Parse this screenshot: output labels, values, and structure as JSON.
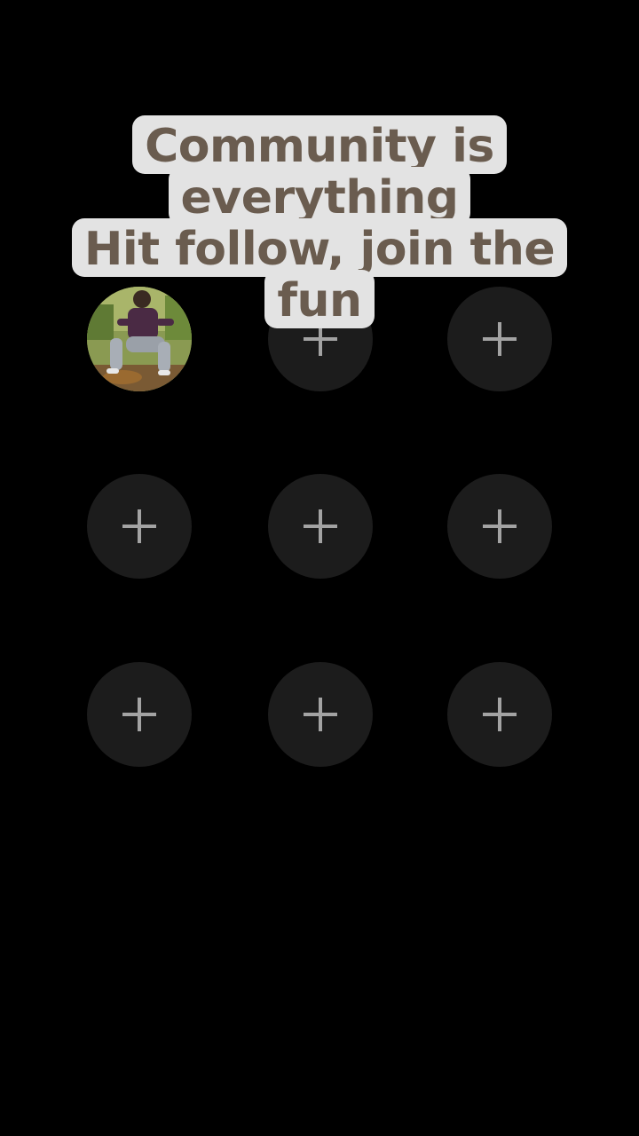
{
  "caption": {
    "lines": [
      "Community is",
      "everything",
      "Hit follow, join the",
      "fun"
    ]
  },
  "grid": {
    "slots": [
      {
        "type": "avatar",
        "icon": "profile-photo"
      },
      {
        "type": "add",
        "icon": "plus-icon"
      },
      {
        "type": "add",
        "icon": "plus-icon"
      },
      {
        "type": "add",
        "icon": "plus-icon"
      },
      {
        "type": "add",
        "icon": "plus-icon"
      },
      {
        "type": "add",
        "icon": "plus-icon"
      },
      {
        "type": "add",
        "icon": "plus-icon"
      },
      {
        "type": "add",
        "icon": "plus-icon"
      },
      {
        "type": "add",
        "icon": "plus-icon"
      }
    ]
  },
  "colors": {
    "background": "#000000",
    "slot": "#1c1c1c",
    "plus": "#a3a3a3",
    "caption_bg": "#e3e3e3",
    "caption_text": "#6a5c4f"
  }
}
